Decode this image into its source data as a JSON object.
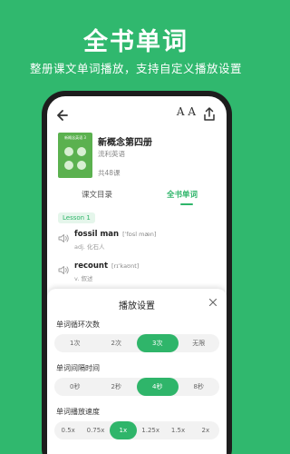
{
  "hero": {
    "title": "全书单词",
    "subtitle": "整册课文单词播放，支持自定义播放设置"
  },
  "topbar": {
    "font_label": "A A"
  },
  "book": {
    "cover_label": "新概念英语 3",
    "title": "新概念第四册",
    "publisher": "流利英语",
    "lessons": "共48课"
  },
  "tabs": [
    {
      "label": "课文目录",
      "active": false
    },
    {
      "label": "全书单词",
      "active": true
    }
  ],
  "lesson_badge": "Lesson 1",
  "words": [
    {
      "word": "fossil man",
      "phonetic": "[ˈfɒsl mæn]",
      "definition": "adj. 化石人"
    },
    {
      "word": "recount",
      "phonetic": "[rɪˈkaʊnt]",
      "definition": "v. 叙述"
    }
  ],
  "sheet": {
    "title": "播放设置",
    "sections": [
      {
        "label": "单词循环次数",
        "options": [
          "1次",
          "2次",
          "3次",
          "无限"
        ],
        "selected": 2
      },
      {
        "label": "单词间隔时间",
        "options": [
          "0秒",
          "2秒",
          "4秒",
          "8秒"
        ],
        "selected": 2
      },
      {
        "label": "单词播放速度",
        "options": [
          "0.5x",
          "0.75x",
          "1x",
          "1.25x",
          "1.5x",
          "2x"
        ],
        "selected": 2
      }
    ]
  },
  "colors": {
    "background": "#30b86e",
    "accent": "#2fb56a"
  }
}
